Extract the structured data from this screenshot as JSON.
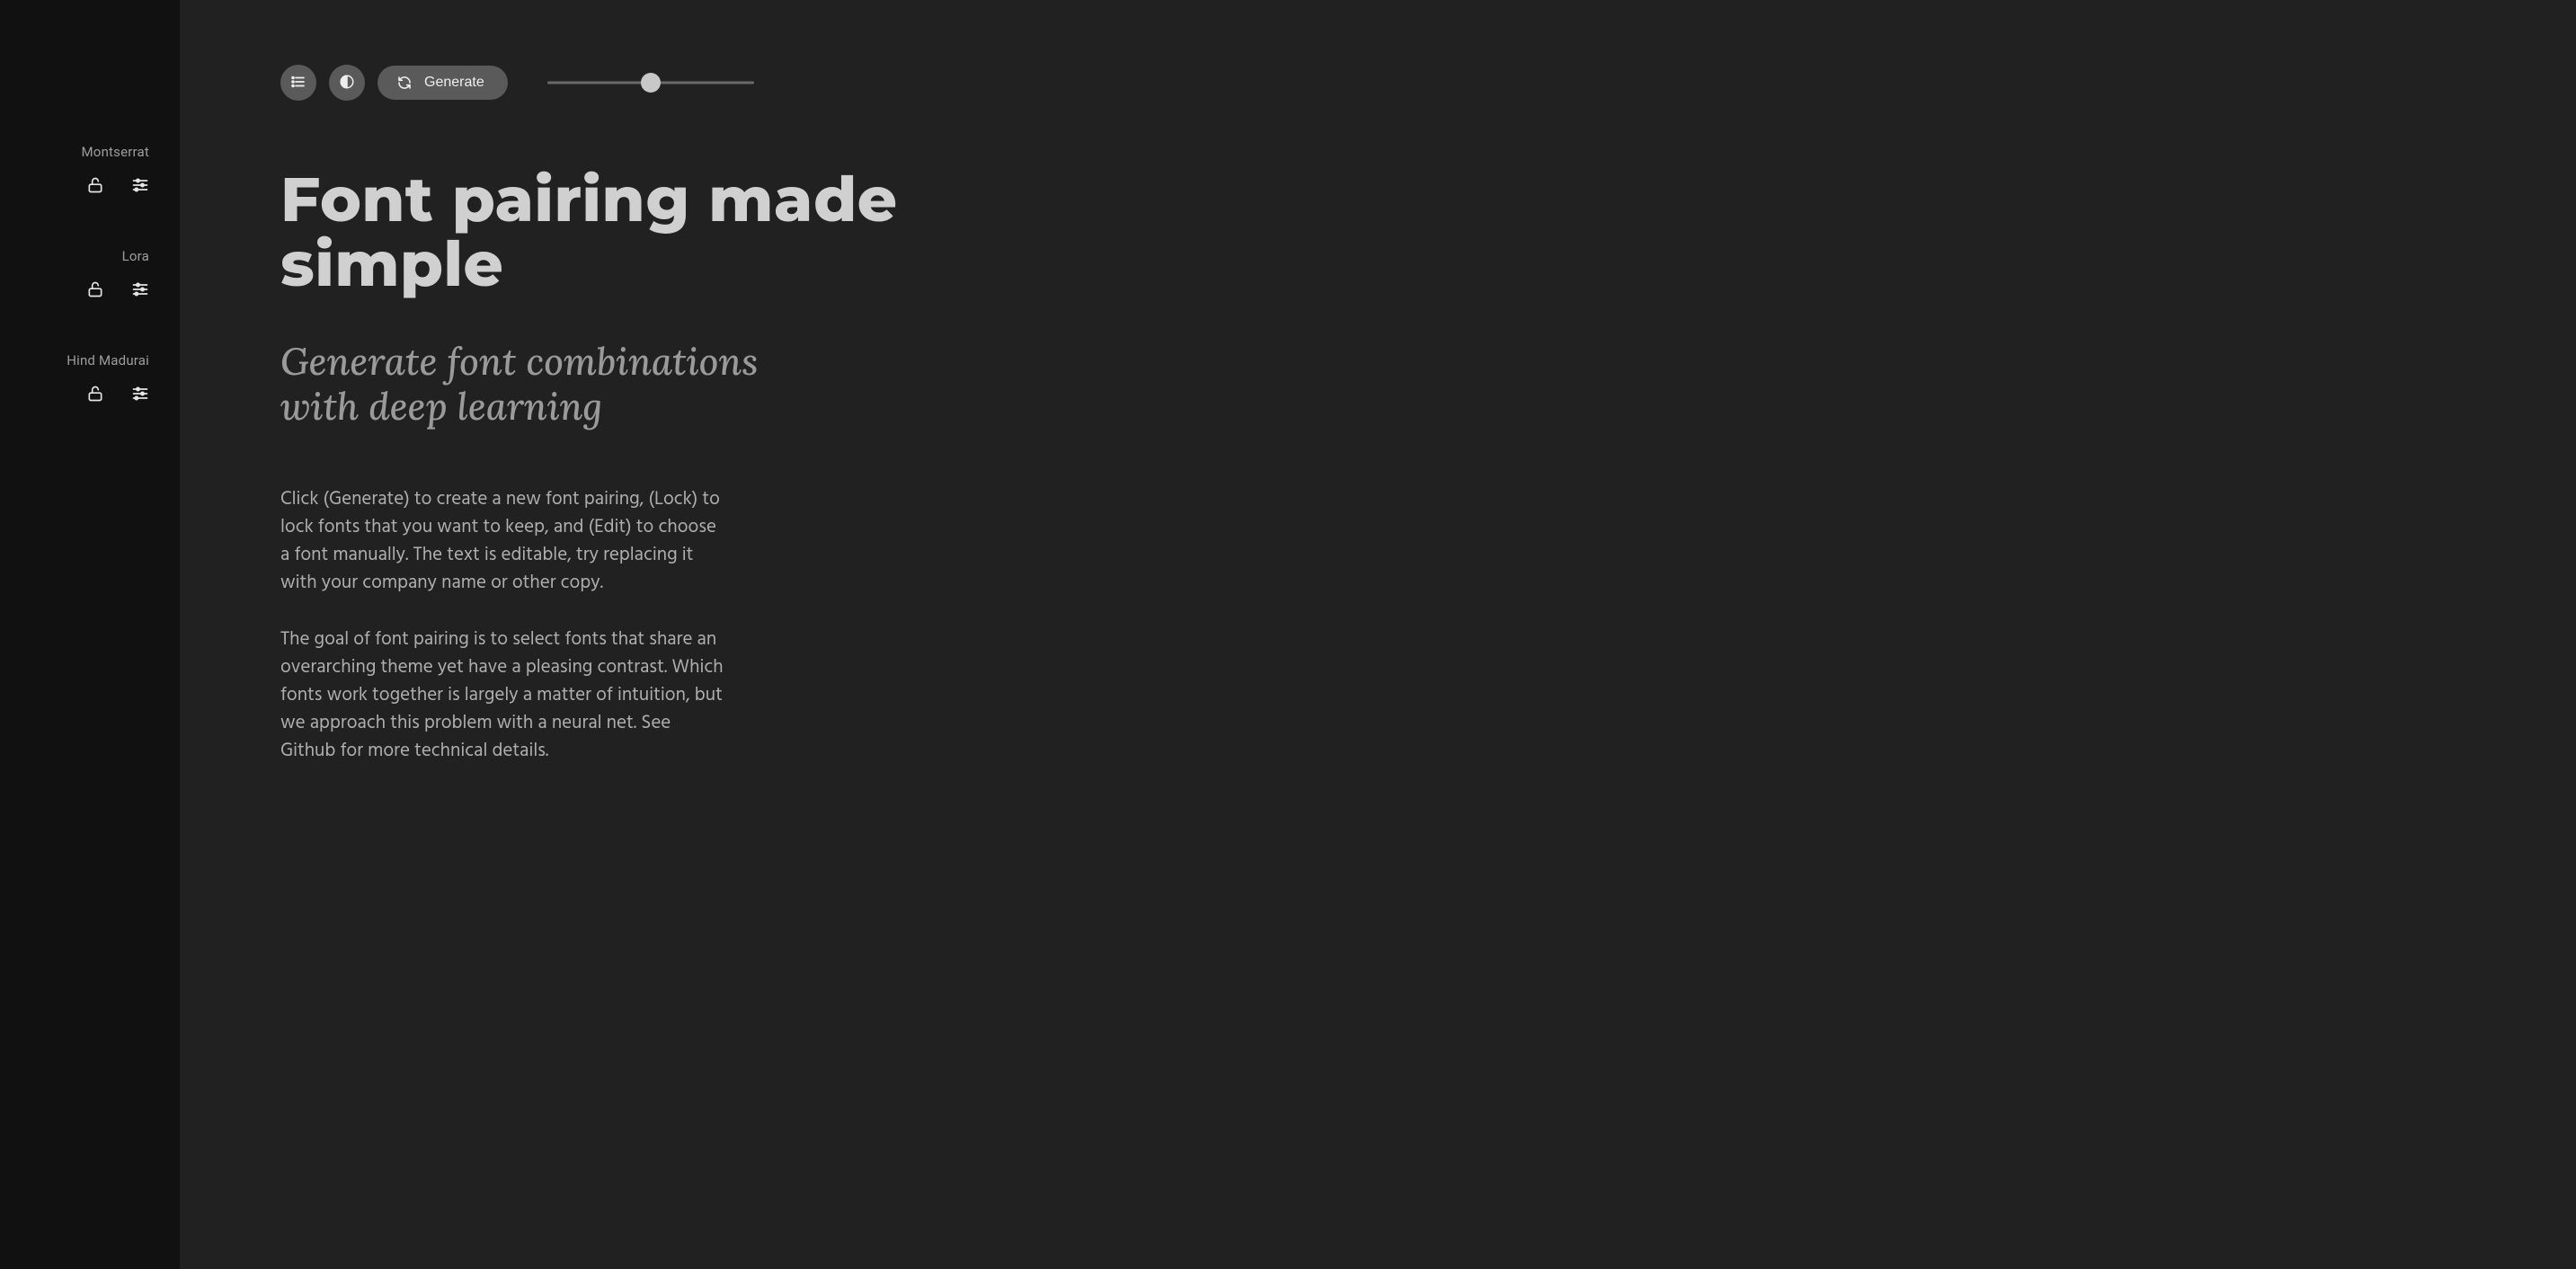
{
  "sidebar": {
    "fonts": [
      {
        "name": "Montserrat"
      },
      {
        "name": "Lora"
      },
      {
        "name": "Hind Madurai"
      }
    ]
  },
  "toolbar": {
    "generate_label": "Generate",
    "slider_value": 50
  },
  "content": {
    "headline": "Font pairing made simple",
    "subhead": "Generate font combinations with deep learning",
    "body_p1": "Click (Generate) to create a new font pairing, (Lock) to lock fonts that you want to keep, and (Edit) to choose a font manually. The text is editable, try replacing it with your company name or other copy.",
    "body_p2": "The goal of font pairing is to select fonts that share an overarching theme yet have a pleasing contrast. Which fonts work together is largely a matter of intuition, but we approach this problem with a neural net. See Github for more technical details."
  },
  "colors": {
    "sidebar_bg": "#111111",
    "main_bg": "#212121",
    "button_bg": "#5a5a5a",
    "text_primary": "#d0d0d0",
    "text_muted": "#9a9a9a"
  }
}
